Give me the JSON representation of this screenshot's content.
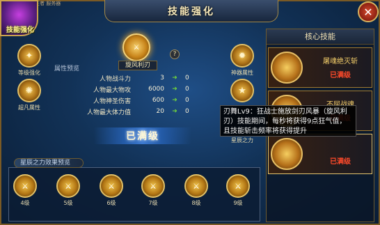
{
  "header": {
    "title": "技能强化",
    "top_hint": "王者 服务器"
  },
  "logo": {
    "label": "技能强化"
  },
  "nav": {
    "left": [
      {
        "label": "等级强化",
        "icon": "level-icon"
      },
      {
        "label": "超凡属性",
        "icon": "transcend-icon"
      }
    ],
    "right": [
      {
        "label": "神器属性",
        "icon": "artifact-icon"
      },
      {
        "label": "星辰之力",
        "icon": "star-icon"
      }
    ]
  },
  "skill": {
    "name": "旋风利刃",
    "help": "?"
  },
  "attributes": {
    "title": "属性预览",
    "rows": [
      {
        "label": "人物战斗力",
        "value": "3",
        "new": "0"
      },
      {
        "label": "人物最大物攻",
        "value": "6000",
        "new": "0"
      },
      {
        "label": "人物神圣伤害",
        "value": "600",
        "new": "0"
      },
      {
        "label": "人物最大体力值",
        "value": "20",
        "new": "0"
      }
    ]
  },
  "status": {
    "max": "已满级"
  },
  "preview": {
    "title": "星辰之力效果预览",
    "levels": [
      "4级",
      "5级",
      "6级",
      "7级",
      "8级",
      "9级"
    ]
  },
  "core_skills": {
    "title": "核心技能",
    "items": [
      {
        "name": "屠魂绝灭斩",
        "status": "已满级"
      },
      {
        "name": "不屈战魂",
        "status": "已满级"
      },
      {
        "name": "",
        "status": "已满级"
      }
    ]
  },
  "tooltip": {
    "text": "刃舞Lv9：狂战士施放剑刃风暴（旋风利刃）技能期间，每秒将获得9点狂气值，且技能斩击频率将获得提升"
  }
}
